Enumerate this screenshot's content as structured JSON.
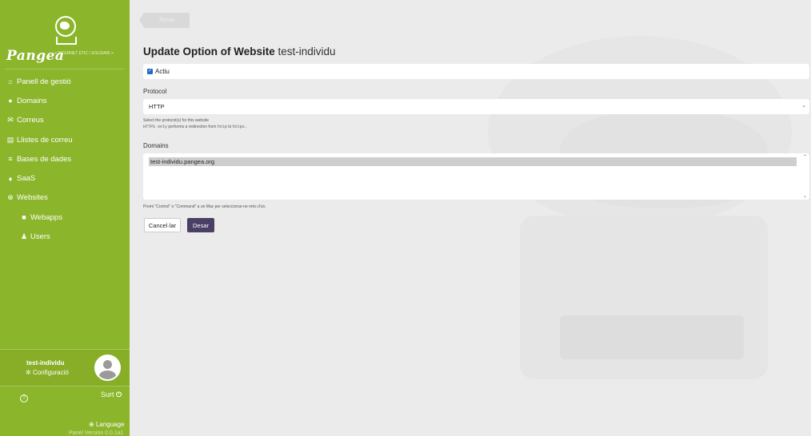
{
  "sidebar": {
    "logo_text": "Pangea",
    "logo_tagline": "< INTERNET ÈTIC I SOLIDARI >",
    "items": [
      {
        "label": "Panell de gestió",
        "icon": "home-icon"
      },
      {
        "label": "Domains",
        "icon": "globe-circle-icon"
      },
      {
        "label": "Correus",
        "icon": "envelope-icon"
      },
      {
        "label": "Llistes de correu",
        "icon": "mailing-list-icon"
      },
      {
        "label": "Bases de dades",
        "icon": "database-icon"
      },
      {
        "label": "SaaS",
        "icon": "flame-icon"
      },
      {
        "label": "Websites",
        "icon": "globe-icon"
      },
      {
        "label": "Webapps",
        "icon": "folder-icon"
      },
      {
        "label": "Users",
        "icon": "user-icon"
      }
    ],
    "user": {
      "name": "test-individu",
      "config": "Configuració"
    },
    "help": "?",
    "logout": "Surt",
    "language": "Language",
    "version": "Panel Version 0.0.1a1"
  },
  "main": {
    "back_label": "Tornar",
    "title_bold": "Update Option of Website",
    "title_name": "test-individu",
    "active_label": "Actiu",
    "active_checked": true,
    "protocol_label": "Protocol",
    "protocol_value": "HTTP",
    "protocol_help": "Select the protocol(s) for this website",
    "protocol_help2_a": "HTTPS only",
    "protocol_help2_b": " performs a redirection from ",
    "protocol_help2_c": "http",
    "protocol_help2_d": " to ",
    "protocol_help2_e": "https.",
    "domains_label": "Domains",
    "domains_options": [
      "test-individu.pangea.org"
    ],
    "domains_help": "Premi \"Control\" o \"Command\" a un Mac per seleccionar-ne més d'un.",
    "cancel_label": "Cancel·lar",
    "save_label": "Desar"
  },
  "colors": {
    "sidebar": "#8bb52a",
    "save_button": "#4c3f66",
    "checkbox": "#2167c5"
  }
}
